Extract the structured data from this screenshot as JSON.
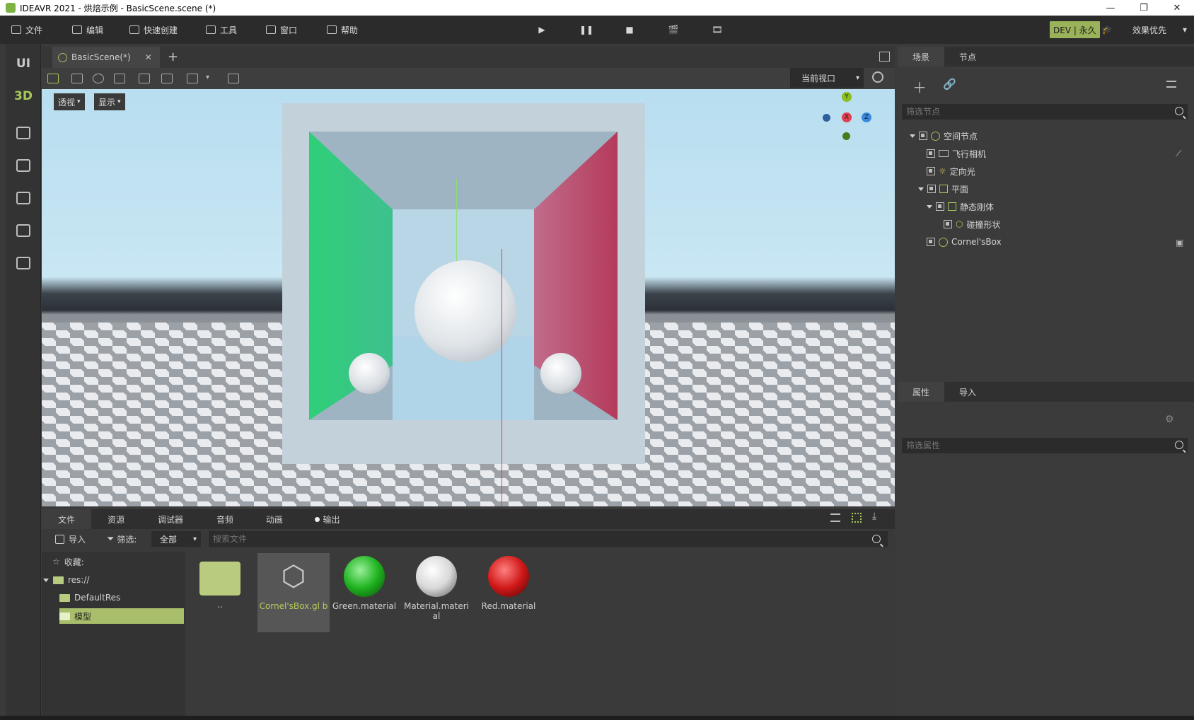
{
  "window": {
    "title": "IDEAVR 2021 - 烘焙示例 - BasicScene.scene (*)",
    "minimize": "—",
    "restore": "❐",
    "close": "✕"
  },
  "menu": {
    "items": [
      {
        "label": "文件",
        "icon": "folder-icon"
      },
      {
        "label": "编辑",
        "icon": "crop-icon"
      },
      {
        "label": "快速创建",
        "icon": "edit-icon"
      },
      {
        "label": "工具",
        "icon": "window-icon"
      },
      {
        "label": "窗口",
        "icon": "frame-icon"
      },
      {
        "label": "帮助",
        "icon": "help-icon"
      }
    ],
    "license_badge": "DEV | 永久",
    "render_mode": "效果优先"
  },
  "left_toolbar": {
    "ui_label": "UI",
    "3d_label": "3D"
  },
  "scene_tabs": {
    "active": "BasicScene(*)",
    "close": "✕",
    "add": "+"
  },
  "viewport": {
    "camera_select": "当前视口",
    "perspective_btn": "透视",
    "display_btn": "显示",
    "gizmo": {
      "y": "Y",
      "x": "X",
      "z": "Z"
    }
  },
  "bottom_panel": {
    "tabs": [
      "文件",
      "资源",
      "调试器",
      "音频",
      "动画",
      "输出"
    ],
    "import_label": "导入",
    "filter_label": "筛选:",
    "filter_value": "全部",
    "search_placeholder": "搜索文件",
    "tree": {
      "favorites": "收藏:",
      "root": "res://",
      "folders": [
        "DefaultRes",
        "模型"
      ]
    },
    "assets": [
      {
        "name": "..",
        "color": "#b9cb7e"
      },
      {
        "name": "Cornel'sBox.gl b",
        "color": "#d0d0d0"
      },
      {
        "name": "Green.material",
        "color": "#1fb31f"
      },
      {
        "name": "Material.materi al",
        "color": "#d8d8d8"
      },
      {
        "name": "Red.material",
        "color": "#d01818"
      }
    ]
  },
  "scene_panel": {
    "tabs": [
      "场景",
      "节点"
    ],
    "filter_placeholder": "筛选节点",
    "nodes": [
      {
        "label": "空间节点",
        "level": 0,
        "expanded": true
      },
      {
        "label": "飞行相机",
        "level": 1
      },
      {
        "label": "定向光",
        "level": 1
      },
      {
        "label": "平面",
        "level": 1,
        "expanded": true
      },
      {
        "label": "静态刚体",
        "level": 2,
        "expanded": true
      },
      {
        "label": "碰撞形状",
        "level": 3
      },
      {
        "label": "Cornel'sBox",
        "level": 1
      }
    ]
  },
  "properties_panel": {
    "tabs": [
      "属性",
      "导入"
    ],
    "filter_placeholder": "筛选属性"
  }
}
